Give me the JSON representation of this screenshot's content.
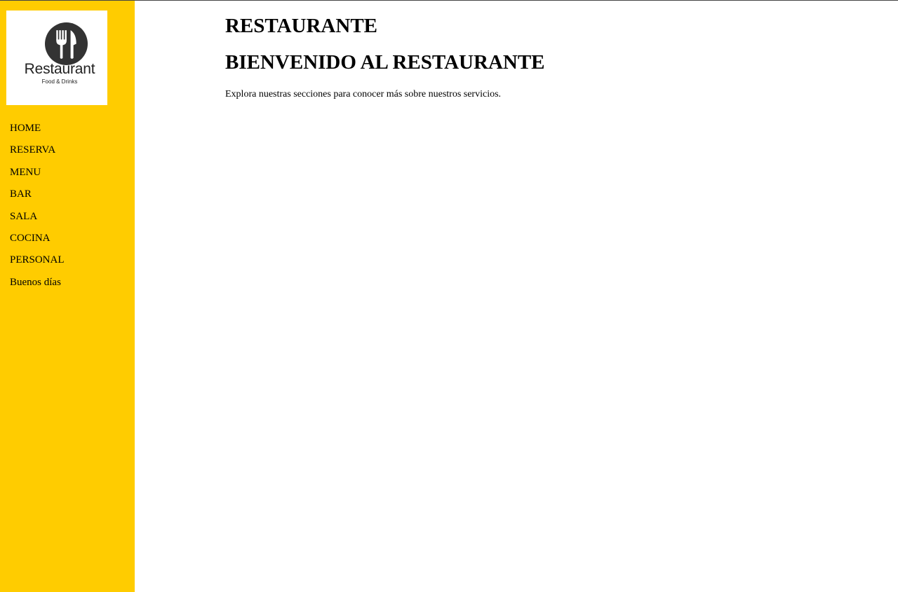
{
  "theme": {
    "sidebar_color": "#ffcc00",
    "background_color": "#ffffff",
    "text_color": "#000000"
  },
  "logo": {
    "icon": "fork-knife-icon",
    "title": "Restaurant",
    "subtitle": "Food & Drinks"
  },
  "sidebar": {
    "items": [
      {
        "label": "HOME"
      },
      {
        "label": "RESERVA"
      },
      {
        "label": "MENU"
      },
      {
        "label": "BAR"
      },
      {
        "label": "SALA"
      },
      {
        "label": "COCINA"
      },
      {
        "label": "PERSONAL"
      },
      {
        "label": "Buenos días"
      }
    ]
  },
  "main": {
    "title": "RESTAURANTE",
    "heading": "BIENVENIDO AL RESTAURANTE",
    "intro": "Explora nuestras secciones para conocer más sobre nuestros servicios."
  }
}
